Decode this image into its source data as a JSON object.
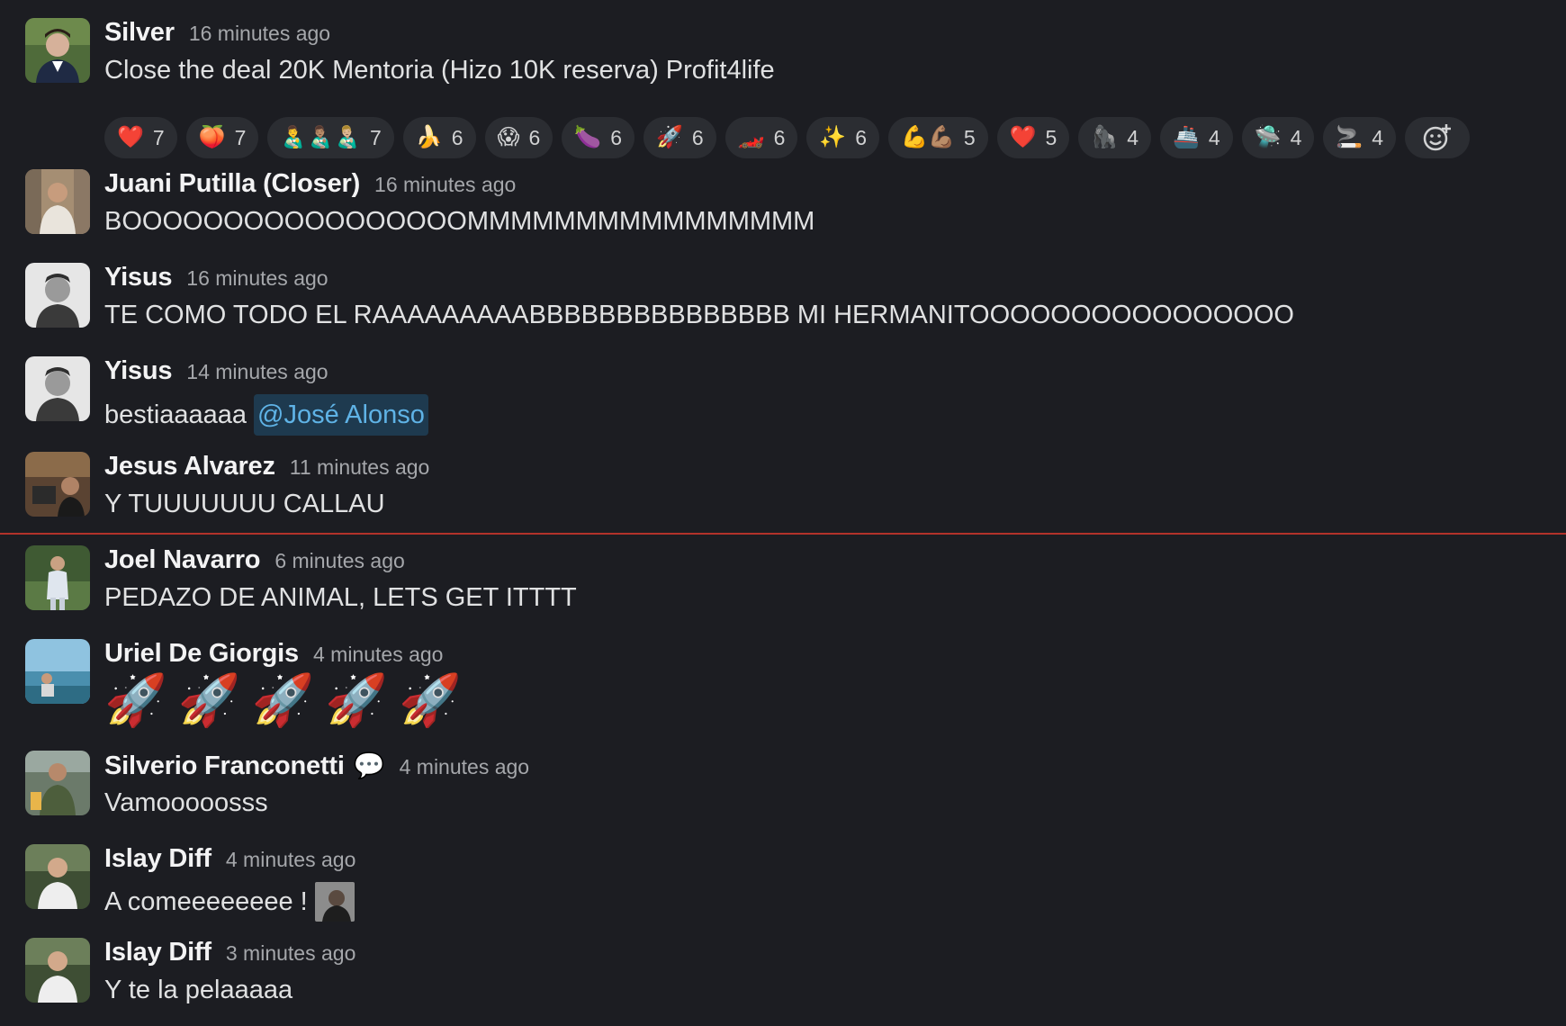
{
  "messages": [
    {
      "author": "Silver",
      "time": "16 minutes ago",
      "text": "Close the deal 20K Mentoria (Hizo 10K reserva) Profit4life",
      "reactions": [
        {
          "emoji": "❤️",
          "count": "7"
        },
        {
          "emoji": "🍑",
          "count": "7"
        },
        {
          "emoji": "👨‍🍼👨🏽‍🍼👨🏼‍🍼",
          "count": "7"
        },
        {
          "emoji": "🍌",
          "count": "6"
        },
        {
          "emoji": "😱",
          "count": "6"
        },
        {
          "emoji": "🍆",
          "count": "6"
        },
        {
          "emoji": "🚀",
          "count": "6"
        },
        {
          "emoji": "🏎️",
          "count": "6"
        },
        {
          "emoji": "✨",
          "count": "6"
        },
        {
          "emoji": "💪💪🏽",
          "count": "5"
        },
        {
          "emoji": "❤️",
          "count": "5"
        },
        {
          "emoji": "🦍",
          "count": "4"
        },
        {
          "emoji": "🚢",
          "count": "4"
        },
        {
          "emoji": "🛸",
          "count": "4"
        },
        {
          "emoji": "🚬",
          "count": "4"
        }
      ]
    },
    {
      "author": "Juani Putilla (Closer)",
      "time": "16 minutes ago",
      "text": "BOOOOOOOOOOOOOOOOOMMMMMMMMMMMMMMMM"
    },
    {
      "author": "Yisus",
      "time": "16 minutes ago",
      "text": "TE COMO TODO EL RAAAAAAAAABBBBBBBBBBBBBBB MI HERMANITOOOOOOOOOOOOOOOO"
    },
    {
      "author": "Yisus",
      "time": "14 minutes ago",
      "text": "bestiaaaaaa",
      "mention": "@José Alonso"
    },
    {
      "author": "Jesus Alvarez",
      "time": "11 minutes ago",
      "text": "Y TUUUUUUU CALLAU"
    },
    {
      "author": "Joel Navarro",
      "time": "6 minutes ago",
      "text": "PEDAZO DE ANIMAL, LETS GET ITTTT"
    },
    {
      "author": "Uriel De Giorgis",
      "time": "4 minutes ago",
      "rockets": [
        "🚀",
        "🚀",
        "🚀",
        "🚀",
        "🚀"
      ]
    },
    {
      "author": "Silverio Franconetti",
      "status_emoji": "💬",
      "time": "4 minutes ago",
      "text": "Vamooooosss"
    },
    {
      "author": "Islay Diff",
      "time": "4 minutes ago",
      "text": "A comeeeeeeee !"
    },
    {
      "author": "Islay Diff",
      "time": "3 minutes ago",
      "text": "Y te la pelaaaaa"
    }
  ],
  "colors": {
    "background": "#1c1d22",
    "mention": "#5fb3e6",
    "new_divider": "#b2322a"
  }
}
